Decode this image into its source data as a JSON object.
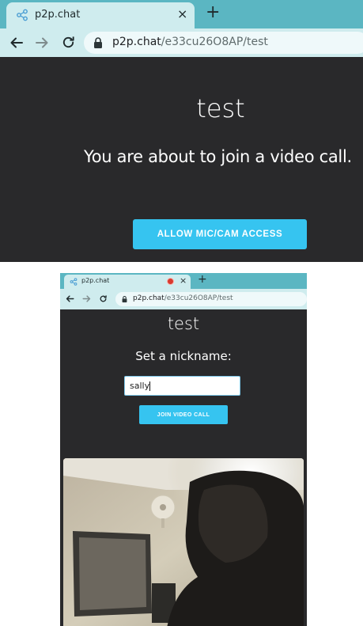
{
  "screenshot_top": {
    "browser": {
      "tab_title": "p2p.chat",
      "tab_icon": "share-icon",
      "url_host": "p2p.chat",
      "url_path": "/e33cu26O8AP/test",
      "new_tab": "+",
      "close": "×"
    },
    "page": {
      "room_name": "test",
      "message": "You are about to join a video call.",
      "allow_button": "ALLOW MIC/CAM ACCESS"
    }
  },
  "screenshot_bottom": {
    "browser": {
      "tab_title": "p2p.chat",
      "tab_icon": "share-icon",
      "recording_indicator": "recording-dot-icon",
      "url_host": "p2p.chat",
      "url_path": "/e33cu26O8AP/test",
      "new_tab": "+",
      "close": "×"
    },
    "page": {
      "room_name": "test",
      "prompt": "Set a nickname:",
      "nickname_value": "sally",
      "join_button": "JOIN VIDEO CALL"
    }
  },
  "colors": {
    "tabstrip": "#5bb6c2",
    "toolbar": "#cfecee",
    "page_bg": "#29292b",
    "button": "#36c4f0"
  }
}
